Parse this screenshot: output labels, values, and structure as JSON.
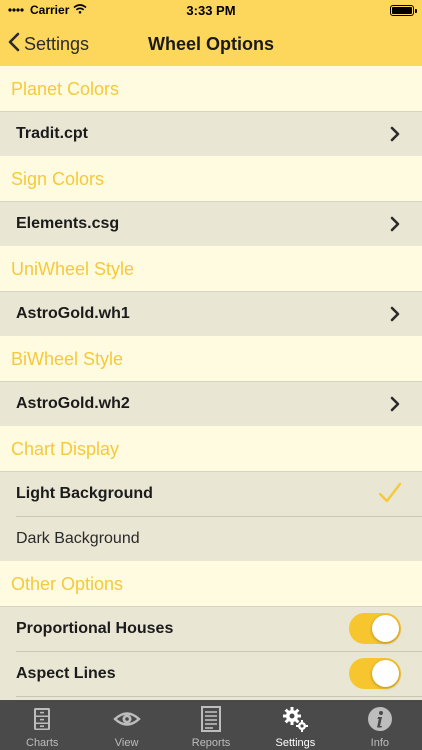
{
  "status_bar": {
    "carrier": "Carrier",
    "time": "3:33 PM"
  },
  "nav": {
    "back_label": "Settings",
    "title": "Wheel Options"
  },
  "sections": {
    "planet_colors": {
      "header": "Planet Colors",
      "value": "Tradit.cpt"
    },
    "sign_colors": {
      "header": "Sign Colors",
      "value": "Elements.csg"
    },
    "uniwheel_style": {
      "header": "UniWheel Style",
      "value": "AstroGold.wh1"
    },
    "biwheel_style": {
      "header": "BiWheel Style",
      "value": "AstroGold.wh2"
    },
    "chart_display": {
      "header": "Chart Display",
      "options": [
        {
          "label": "Light Background",
          "selected": true
        },
        {
          "label": "Dark Background",
          "selected": false
        }
      ]
    },
    "other_options": {
      "header": "Other Options",
      "toggles": [
        {
          "label": "Proportional Houses",
          "on": true
        },
        {
          "label": "Aspect Lines",
          "on": true
        }
      ]
    }
  },
  "tabs": [
    {
      "label": "Charts",
      "icon": "cabinet-icon",
      "active": false
    },
    {
      "label": "View",
      "icon": "eye-icon",
      "active": false
    },
    {
      "label": "Reports",
      "icon": "document-icon",
      "active": false
    },
    {
      "label": "Settings",
      "icon": "gears-icon",
      "active": true
    },
    {
      "label": "Info",
      "icon": "info-icon",
      "active": false
    }
  ],
  "colors": {
    "accent": "#fdd65c",
    "header_text": "#f5c93a",
    "row_bg": "#e9e6d4",
    "page_bg": "#fffbe0",
    "tabbar_bg": "#4a4a4a",
    "toggle_on": "#f7c62e"
  }
}
